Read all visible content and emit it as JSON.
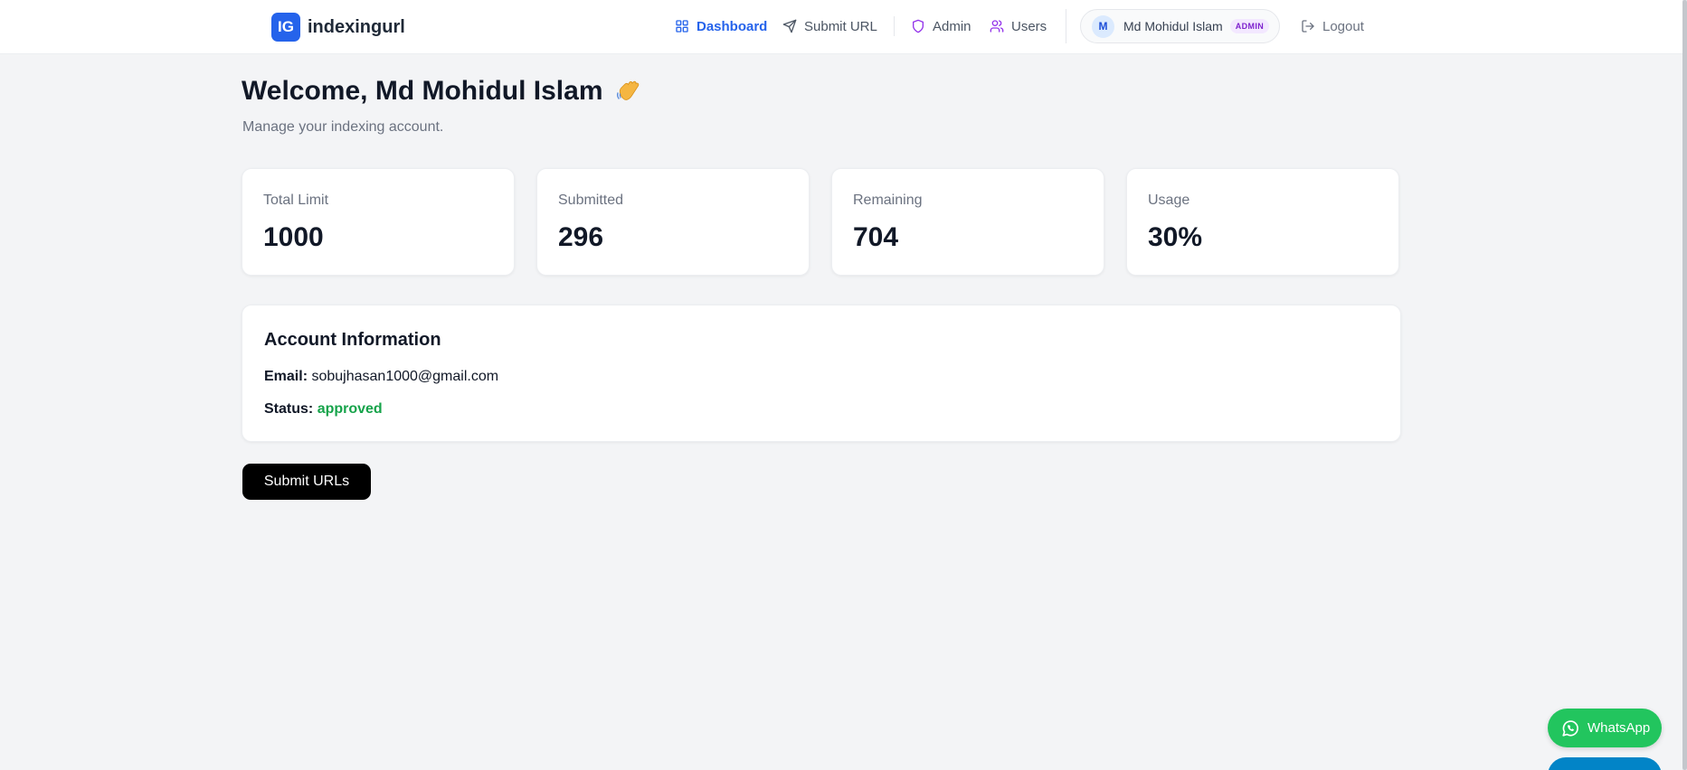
{
  "header": {
    "logo_text": "IG",
    "brand_name": "indexingurl",
    "nav": {
      "dashboard": "Dashboard",
      "submit_url": "Submit URL",
      "admin": "Admin",
      "users": "Users"
    },
    "user": {
      "avatar_letter": "M",
      "name": "Md Mohidul Islam",
      "role": "ADMIN"
    },
    "logout": "Logout"
  },
  "welcome": {
    "title": "Welcome, Md Mohidul Islam",
    "subtitle": "Manage your indexing account."
  },
  "stats": [
    {
      "label": "Total Limit",
      "value": "1000"
    },
    {
      "label": "Submitted",
      "value": "296"
    },
    {
      "label": "Remaining",
      "value": "704"
    },
    {
      "label": "Usage",
      "value": "30%"
    }
  ],
  "account": {
    "title": "Account Information",
    "email_label": "Email:",
    "email": "sobujhasan1000@gmail.com",
    "status_label": "Status:",
    "status": "approved"
  },
  "submit_button": "Submit URLs",
  "whatsapp": "WhatsApp",
  "colors": {
    "primary": "#2563eb",
    "admin_accent": "#9333ea",
    "status_approved": "#16a34a",
    "whatsapp": "#22c55e"
  },
  "icons": {
    "dashboard": "grid-icon",
    "submit_url": "send-icon",
    "admin": "shield-icon",
    "users": "users-icon",
    "logout": "logout-icon",
    "wave": "waving-hand-icon",
    "whatsapp": "whatsapp-icon"
  }
}
